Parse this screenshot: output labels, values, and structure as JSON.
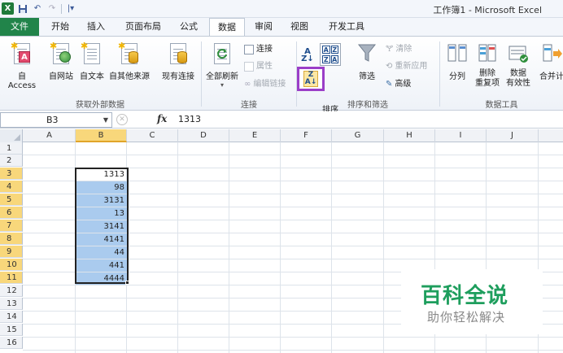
{
  "window": {
    "title": "工作簿1 - Microsoft Excel",
    "logo": "X"
  },
  "qat": {
    "undo_icon": "undo-icon",
    "redo_icon": "redo-icon",
    "save_icon": "save-icon",
    "customize": "|▾"
  },
  "tabs": [
    {
      "label": "文件"
    },
    {
      "label": "开始"
    },
    {
      "label": "插入"
    },
    {
      "label": "页面布局"
    },
    {
      "label": "公式"
    },
    {
      "label": "数据"
    },
    {
      "label": "审阅"
    },
    {
      "label": "视图"
    },
    {
      "label": "开发工具"
    }
  ],
  "active_tab": "数据",
  "ribbon": {
    "external": {
      "label": "获取外部数据",
      "access": "自 Access",
      "web": "自网站",
      "text": "自文本",
      "other": "自其他来源",
      "existing": "现有连接"
    },
    "connections": {
      "label": "连接",
      "refresh_all": "全部刷新",
      "connections": "连接",
      "properties": "属性",
      "edit_links": "编辑链接"
    },
    "sort_filter": {
      "label": "排序和筛选",
      "sort_az": "A→Z",
      "sort": "排序",
      "filter": "筛选",
      "clear": "清除",
      "reapply": "重新应用",
      "advanced": "高级"
    },
    "data_tools": {
      "label": "数据工具",
      "text_to_columns": "分列",
      "remove_dup": "删除\n重复项",
      "validation": "数据\n有效性",
      "consolidate": "合并计"
    }
  },
  "formula_bar": {
    "name_box": "B3",
    "fx": "fx",
    "value": "1313"
  },
  "columns": [
    "A",
    "B",
    "C",
    "D",
    "E",
    "F",
    "G",
    "H",
    "I",
    "J"
  ],
  "rows": [
    "1",
    "2",
    "3",
    "4",
    "5",
    "6",
    "7",
    "8",
    "9",
    "10",
    "11",
    "12",
    "13",
    "14",
    "15",
    "16"
  ],
  "cells_b": [
    "",
    "",
    "1313",
    "98",
    "3131",
    "13",
    "3141",
    "4141",
    "44",
    "441",
    "4444"
  ],
  "watermark": {
    "title": "百科全说",
    "subtitle": "助你轻松解决"
  }
}
